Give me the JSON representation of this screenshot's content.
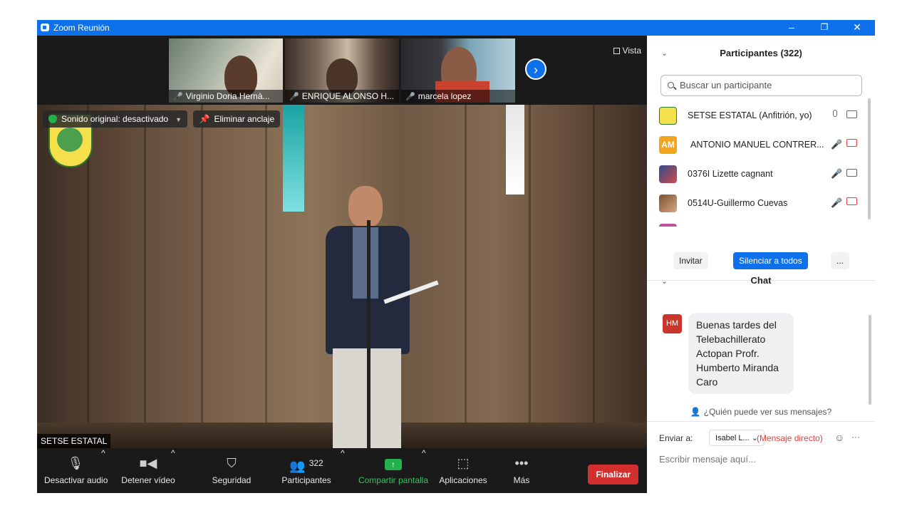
{
  "window": {
    "title": "Zoom Reunión",
    "controls": [
      "–",
      "❐",
      "✕"
    ]
  },
  "thumbnails": [
    {
      "name": "Virginio Doria Hernà..."
    },
    {
      "name": "ENRIQUE ALONSO H..."
    },
    {
      "name": "marcela lopez"
    }
  ],
  "view_label": "Vista",
  "badges": {
    "audio": "Sonido original: desactivado",
    "unpin": "Eliminar anclaje"
  },
  "speaker_name": "SETSE ESTATAL",
  "toolbar": {
    "mute": "Desactivar audio",
    "video": "Detener vídeo",
    "security": "Seguridad",
    "participants": "Participantes",
    "participants_count": "322",
    "share": "Compartir pantalla",
    "apps": "Aplicaciones",
    "more": "Más",
    "end": "Finalizar"
  },
  "participants_panel": {
    "title": "Participantes (322)",
    "search_placeholder": "Buscar un participante",
    "list": [
      {
        "name": "SETSE ESTATAL (Anfitrión, yo)"
      },
      {
        "initials": "AM",
        "name": "ANTONIO MANUEL CONTRER..."
      },
      {
        "name": "0376I Lizette cagnant"
      },
      {
        "name": "0514U-Guillermo Cuevas"
      }
    ],
    "invite": "Invitar",
    "mute_all": "Silenciar a todos",
    "more": "..."
  },
  "chat": {
    "title": "Chat",
    "sender_initials": "HM",
    "message": "Buenas tardes del Telebachillerato Actopan Profr. Humberto Miranda Caro",
    "who_can_see": "¿Quién puede ver sus mensajes?",
    "send_to_label": "Enviar a:",
    "recipient": "Isabel L...",
    "direct": "(Mensaje directo)",
    "input_placeholder": "Escribir mensaje aquí..."
  },
  "colors": {
    "zoom_blue": "#0e71eb",
    "end_red": "#d32f2f",
    "share_green": "#23b14d"
  }
}
